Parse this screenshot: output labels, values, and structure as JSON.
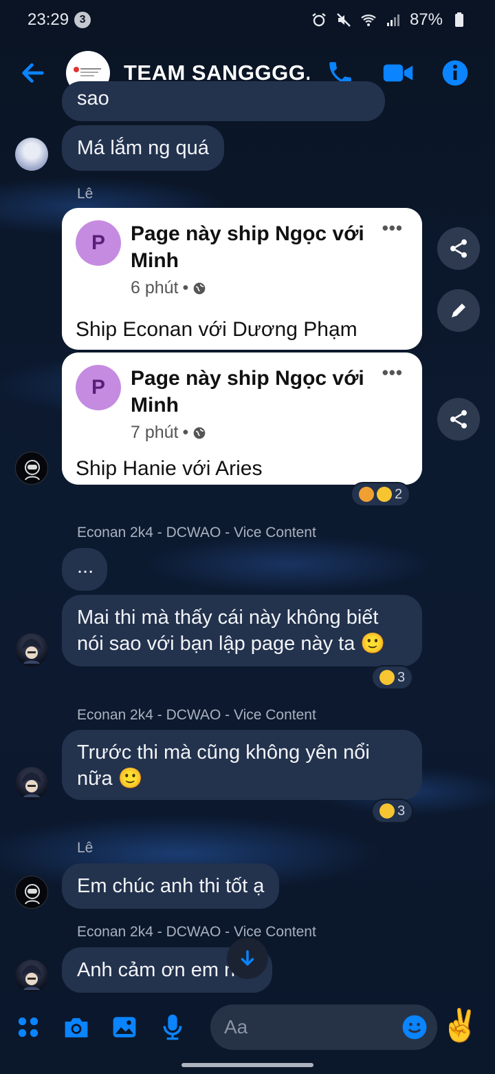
{
  "status_bar": {
    "time": "23:29",
    "notification_count": "3",
    "battery": "87%"
  },
  "header": {
    "title": "TEAM SANGGGG...",
    "icons": [
      "back-arrow-icon",
      "phone-icon",
      "video-icon",
      "info-icon"
    ]
  },
  "colors": {
    "accent": "#0a84ff",
    "bubble": "#23324d",
    "background": "#0b1526"
  },
  "messages": {
    "m0": {
      "text": "sao"
    },
    "m1": {
      "text": "Má lắm ng quá"
    },
    "sender_le_1": "Lê",
    "card1": {
      "page_initial": "P",
      "page_name": "Page này ship Ngọc với Minh",
      "time": "6 phút",
      "text": "Ship Econan với Dương Phạm"
    },
    "card2": {
      "page_initial": "P",
      "page_name": "Page này ship Ngọc với Minh",
      "time": "7 phút",
      "text": "Ship Hanie với Aries"
    },
    "card2_reaction_count": "2",
    "sender_econan_1": "Econan 2k4 - DCWAO - Vice Content",
    "m2": {
      "text": "..."
    },
    "m3": {
      "text": "Mai thi mà thấy cái này không biết nói sao với bạn lập page này ta 🙂"
    },
    "m3_reaction_count": "3",
    "sender_econan_2": "Econan 2k4 - DCWAO - Vice Content",
    "m4": {
      "text": "Trước thi mà cũng không yên nổi nữa 🙂"
    },
    "m4_reaction_count": "3",
    "sender_le_2": "Lê",
    "m5": {
      "text": "Em chúc anh thi tốt ạ"
    },
    "sender_econan_3": "Econan 2k4 - DCWAO - Vice Content",
    "m6": {
      "text": "Anh cảm ơn em nha"
    }
  },
  "composer": {
    "placeholder": "Aa",
    "icons": [
      "apps-icon",
      "camera-icon",
      "gallery-icon",
      "mic-icon",
      "emoji-icon"
    ],
    "quick_reaction": "✌️"
  }
}
